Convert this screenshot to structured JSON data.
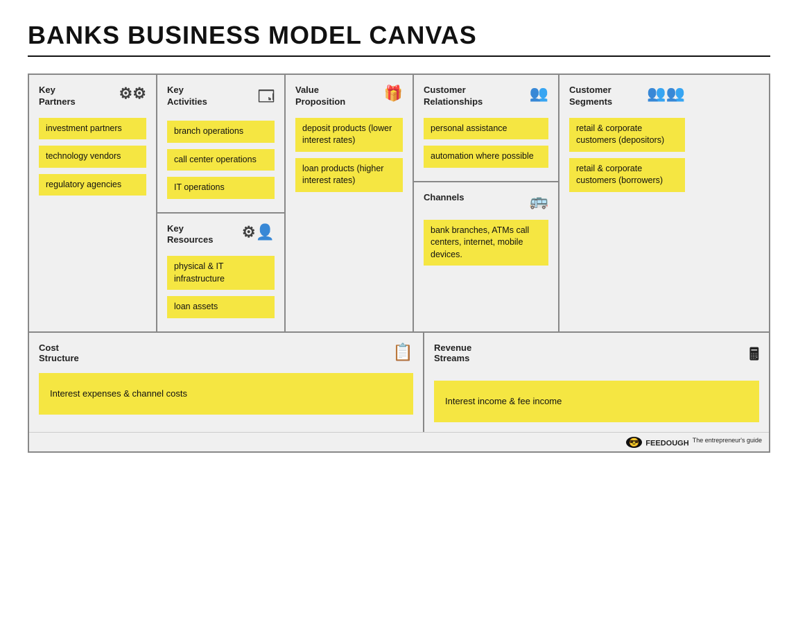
{
  "title": "BANKS BUSINESS MODEL CANVAS",
  "sections": {
    "keyPartners": {
      "header": "Key\nPartners",
      "icon": "⚙",
      "items": [
        "investment partners",
        "technology vendors",
        "regulatory agencies"
      ]
    },
    "keyActivities": {
      "header": "Key\nActivities",
      "icon": "🖥",
      "items": [
        "branch operations",
        "call center operations",
        "IT operations"
      ]
    },
    "keyResources": {
      "header": "Key\nResources",
      "icon": "⚙👤",
      "items": [
        "physical & IT infrastructure",
        "loan assets"
      ]
    },
    "valueProposition": {
      "header": "Value\nProposition",
      "icon": "🎁",
      "items": [
        "deposit products (lower interest rates)",
        "loan products (higher interest rates)"
      ]
    },
    "customerRelationships": {
      "header": "Customer\nRelationships",
      "icon": "👥",
      "items": [
        "personal assistance",
        "automation where possible"
      ]
    },
    "channels": {
      "header": "Channels",
      "icon": "🚌",
      "items": [
        "bank branches, ATMs call centers, internet, mobile devices."
      ]
    },
    "customerSegments": {
      "header": "Customer\nSegments",
      "icon": "👥👥",
      "items": [
        "retail & corporate customers (depositors)",
        "retail & corporate customers (borrowers)"
      ]
    },
    "costStructure": {
      "header": "Cost\nStructure",
      "icon": "📋",
      "item": "Interest expenses & channel costs"
    },
    "revenueStreams": {
      "header": "Revenue\nStreams",
      "icon": "🖩",
      "item": "Interest income & fee income"
    }
  },
  "footer": {
    "brand": "FEEDOUGH",
    "tagline": "The entrepreneur's guide"
  }
}
